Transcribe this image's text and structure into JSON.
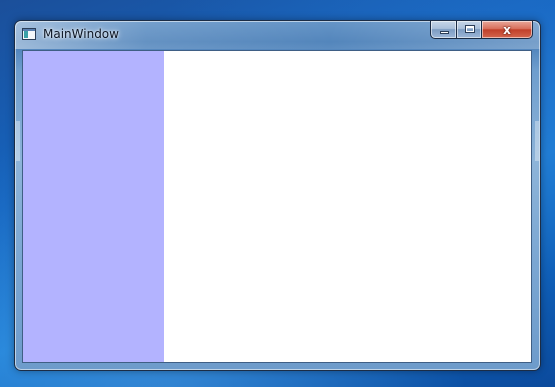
{
  "window": {
    "title": "MainWindow"
  },
  "caption_buttons": {
    "minimize_icon": "minimize-icon",
    "maximize_icon": "maximize-icon",
    "close_glyph": "x"
  },
  "colors": {
    "left_panel": "#b3b3ff",
    "right_panel": "#ffffff",
    "close_button": "#c1402a"
  }
}
